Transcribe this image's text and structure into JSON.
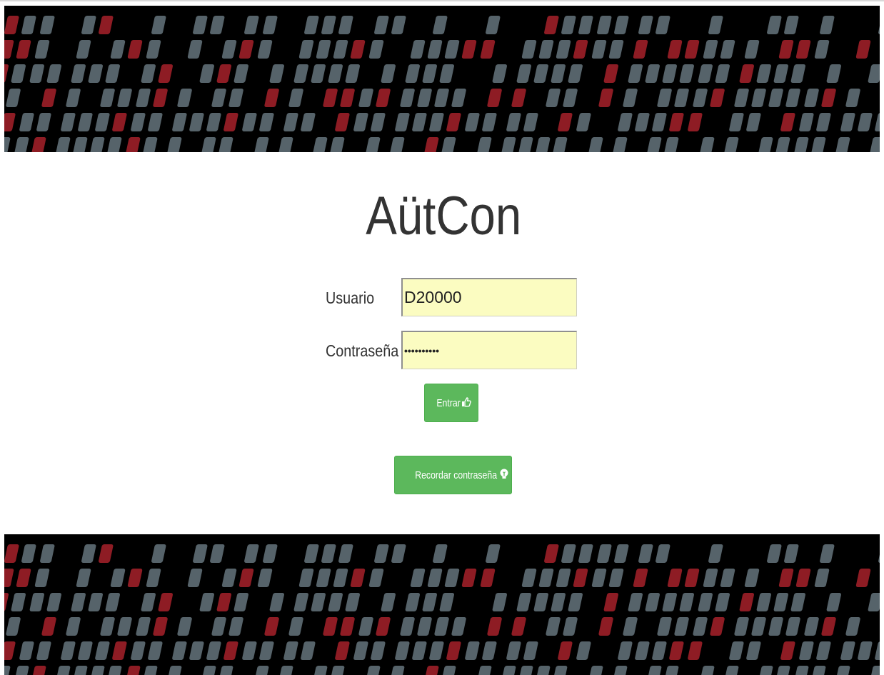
{
  "app": {
    "title": "AütCon"
  },
  "login_form": {
    "username_label": "Usuario",
    "username_value": "D20000",
    "password_label": "Contraseña",
    "password_value": "••••••••••",
    "enter_label": "Entrar",
    "enter_icon": "thumbs-up-icon",
    "remember_label": "Recordar contraseña",
    "remember_icon": "lightbulb-icon"
  },
  "colors": {
    "banner_background": "#000000",
    "banner_tile_gray": "#56636a",
    "banner_tile_red": "#8e1c24",
    "input_background": "#fbfcc1",
    "button_green": "#5cb85c",
    "title_text": "#333333"
  }
}
